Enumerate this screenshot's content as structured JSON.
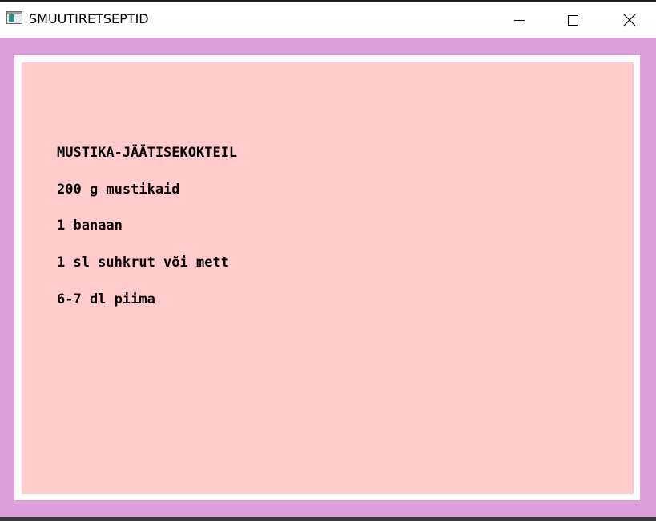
{
  "window": {
    "title": "SMUUTIRETSEPTID",
    "app_icon": "window-app-icon",
    "controls": {
      "minimize_icon": "minimize-icon",
      "maximize_icon": "maximize-icon",
      "close_icon": "close-icon"
    }
  },
  "recipe": {
    "title": "MUSTIKA-JÄÄTISEKOKTEIL",
    "ingredients": [
      "200 g mustikaid",
      "1 banaan",
      "1 sl suhkrut või mett",
      "6-7 dl piima"
    ]
  },
  "colors": {
    "window_background": "#dda0dd",
    "panel_border": "#ffffff",
    "panel_background": "#ffcccb",
    "text": "#000000"
  }
}
